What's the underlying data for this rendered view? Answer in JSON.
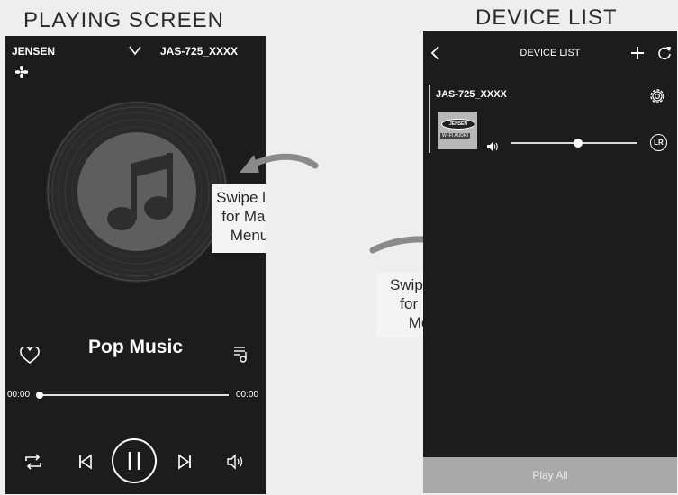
{
  "captions": {
    "left": "PLAYING SCREEN",
    "right": "DEVICE LIST"
  },
  "playing": {
    "brand": "JENSEN",
    "device_name": "JAS-725_XXXX",
    "track_title": "Pop Music",
    "time_elapsed": "00:00",
    "time_total": "00:00",
    "progress": 0.0,
    "icons": {
      "collapse": "chevron-down-icon",
      "menu": "fan-menu-icon",
      "favorite": "heart-icon",
      "playlist": "playlist-icon",
      "repeat": "repeat-icon",
      "previous": "skip-previous-icon",
      "pause": "pause-icon",
      "next": "skip-next-icon",
      "volume": "speaker-volume-icon"
    }
  },
  "devices": {
    "title": "DEVICE LIST",
    "items": [
      {
        "name": "JAS-725_XXXX",
        "volume": 0.53,
        "channel": "LR",
        "thumb_brand": "JENSEN",
        "thumb_sub": "WI-FI AUDIO"
      }
    ],
    "play_all_label": "Play All",
    "icons": {
      "back": "chevron-left-icon",
      "add": "plus-icon",
      "refresh": "refresh-icon",
      "settings": "gear-icon",
      "volume": "speaker-volume-icon"
    }
  },
  "callouts": {
    "left": [
      "Swipe left",
      "for Main",
      "Menu"
    ],
    "right": [
      "Swipe right",
      "for Main",
      "Menu"
    ]
  },
  "colors": {
    "screen_bg": "#1c1c1c",
    "page_bg": "#eeeeee",
    "play_all_bg": "#a9a9a9",
    "arrow": "#8a8a8a"
  }
}
